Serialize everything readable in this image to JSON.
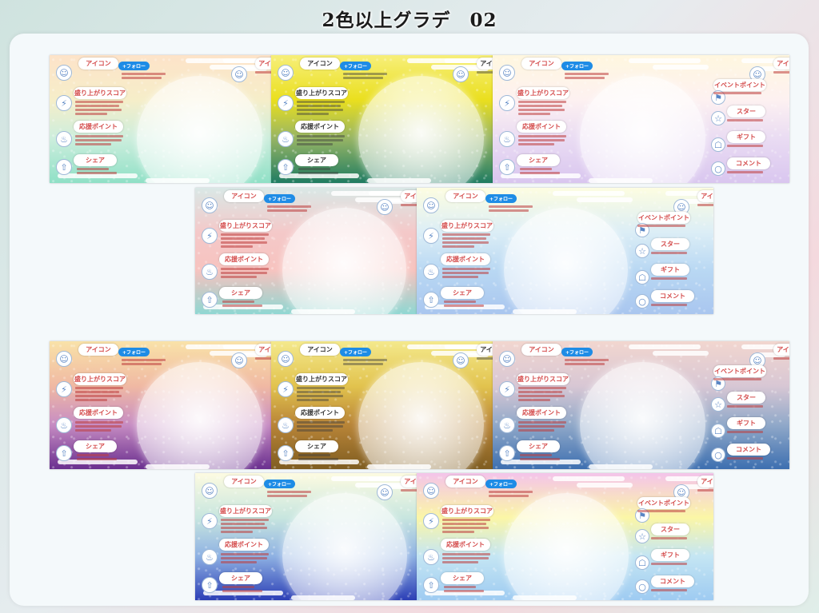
{
  "title": "2色以上グラデ　02",
  "labels": {
    "icon": "アイコン",
    "follow": "+フォロー",
    "score": "盛り上がりスコア",
    "support": "応援ポイント",
    "share": "シェア",
    "event": "イベントポイント",
    "star": "スター",
    "gift": "ギフト",
    "comment": "コメント"
  },
  "icons": {
    "person": "person-icon",
    "bolt": "lightning-icon",
    "flame": "flame-icon",
    "share": "share-icon",
    "flag": "flag-icon",
    "star": "star-icon",
    "gift": "gift-icon",
    "comment": "comment-icon"
  },
  "thumbnails": [
    {
      "id": "t1",
      "variant": "cropped",
      "gradient": [
        "#fde3c9",
        "#f6eec9",
        "#cdeedd",
        "#8fe0c6"
      ],
      "text": "red"
    },
    {
      "id": "t2",
      "variant": "cropped",
      "gradient": [
        "#f7ef7a",
        "#eadf1e",
        "#97b564",
        "#1f7c62"
      ],
      "text": "dark"
    },
    {
      "id": "t3",
      "variant": "full",
      "gradient": [
        "#fff7df",
        "#fdf1f1",
        "#eadcf3",
        "#d9c6ef"
      ],
      "text": "red"
    },
    {
      "id": "t4",
      "variant": "cropped",
      "gradient": [
        "#d9e8e6",
        "#f4c9c9",
        "#f7c3bf",
        "#8fd7d2"
      ],
      "text": "red"
    },
    {
      "id": "t5",
      "variant": "full",
      "gradient": [
        "#fdfde1",
        "#dceef6",
        "#b9d8f3",
        "#a9c6ef"
      ],
      "text": "red"
    },
    {
      "id": "t6",
      "variant": "cropped",
      "gradient": [
        "#f9e2a8",
        "#f0b9a3",
        "#c78dc3",
        "#6a2f8f"
      ],
      "text": "red"
    },
    {
      "id": "t7",
      "variant": "cropped",
      "gradient": [
        "#f4e98c",
        "#e2c34e",
        "#b98538",
        "#7f5d21"
      ],
      "text": "dark"
    },
    {
      "id": "t8",
      "variant": "full",
      "gradient": [
        "#f2d6cf",
        "#d8c7d4",
        "#91a9c9",
        "#3d6fb0"
      ],
      "text": "red"
    },
    {
      "id": "t9",
      "variant": "cropped",
      "gradient": [
        "#fdfbe1",
        "#c8e6df",
        "#8fb2e3",
        "#2c3fb6"
      ],
      "text": "red"
    },
    {
      "id": "t10",
      "variant": "full",
      "gradient": [
        "#f4c4ea",
        "#fbf6a6",
        "#c5e6f3",
        "#9ecbf2"
      ],
      "text": "red"
    }
  ]
}
